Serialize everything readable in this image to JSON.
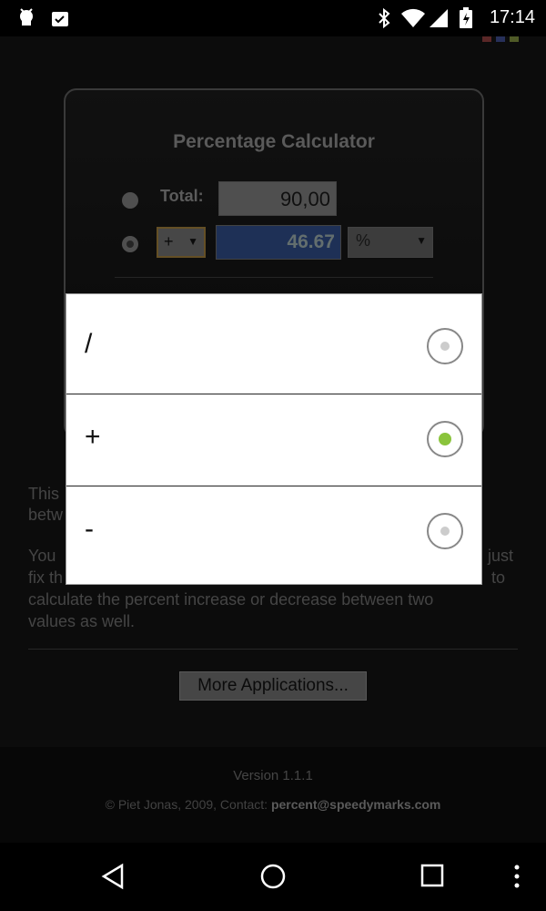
{
  "status_bar": {
    "time": "17:14"
  },
  "calculator": {
    "title": "Percentage Calculator",
    "total_label": "Total:",
    "total_value": "90,00",
    "operator_selected": "+",
    "percent_value": "46.67",
    "unit_selected": "%"
  },
  "description": {
    "line1": "This",
    "line2": "betw",
    "line3_left": "You",
    "line3_right": "just",
    "line4_left": "fix th",
    "line4_right": "to",
    "line5": "calculate the percent increase or decrease between two",
    "line6": "values as well."
  },
  "more_button": "More Applications...",
  "footer": {
    "version": "Version 1.1.1",
    "copyright_prefix": "© Piet Jonas, 2009, Contact:",
    "email": "percent@speedymarks.com"
  },
  "dialog": {
    "options": [
      {
        "label": "/",
        "selected": false
      },
      {
        "label": "+",
        "selected": true
      },
      {
        "label": "-",
        "selected": false
      }
    ]
  },
  "colors": {
    "accent_selected": "#8ac43c",
    "value_field": "#2f4a84"
  }
}
